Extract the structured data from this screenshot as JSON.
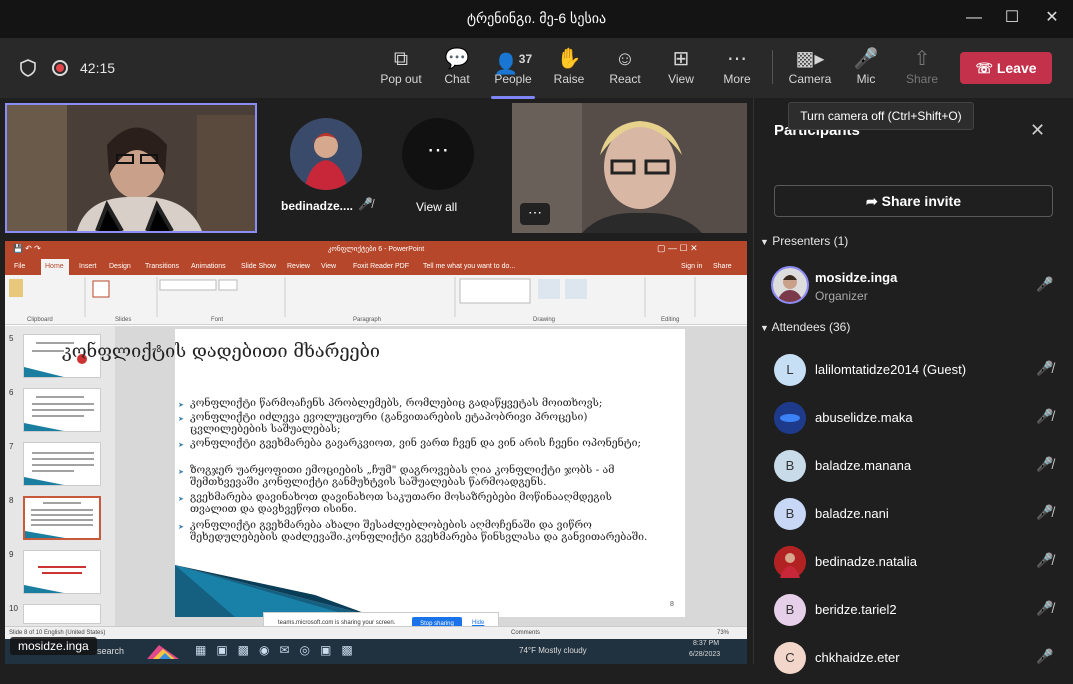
{
  "window": {
    "title": "ტრენინგი. მე-6 სესია"
  },
  "call": {
    "duration": "42:15"
  },
  "toolbar": {
    "popout": "Pop out",
    "chat": "Chat",
    "people": "People",
    "people_count": "37",
    "raise": "Raise",
    "react": "React",
    "view": "View",
    "more": "More",
    "camera": "Camera",
    "mic": "Mic",
    "share": "Share",
    "leave": "Leave"
  },
  "tooltip": "Turn camera off (Ctrl+Shift+O)",
  "tiles": {
    "bedinadze_name": "bedinadze....",
    "view_all": "View all",
    "self_name": "mosidze.inga"
  },
  "panel": {
    "title": "Participants",
    "share_invite": "Share invite",
    "presenters_header": "Presenters (1)",
    "attendees_header": "Attendees (36)",
    "presenter": {
      "name": "mosidze.inga",
      "role": "Organizer"
    },
    "attendees": [
      {
        "initial": "L",
        "name": "lalilomtatidze2014 (Guest)",
        "color": "#c7dff5"
      },
      {
        "initial": "",
        "name": "abuselidze.maka",
        "color": "#1e3a8a"
      },
      {
        "initial": "B",
        "name": "baladze.manana",
        "color": "#c8dbe8"
      },
      {
        "initial": "B",
        "name": "baladze.nani",
        "color": "#c7d7f5"
      },
      {
        "initial": "",
        "name": "bedinadze.natalia",
        "color": "#b22222"
      },
      {
        "initial": "B",
        "name": "beridze.tariel2",
        "color": "#e6cfe8"
      },
      {
        "initial": "C",
        "name": "chkhaidze.eter",
        "color": "#f2d6c9"
      }
    ]
  },
  "ppt": {
    "window_title": "კონფლიქტები 6 - PowerPoint",
    "tabs": [
      "File",
      "Home",
      "Insert",
      "Design",
      "Transitions",
      "Animations",
      "Slide Show",
      "Review",
      "View",
      "Foxit Reader PDF"
    ],
    "tell_me": "Tell me what you want to do...",
    "sign_in": "Sign in",
    "share": "Share",
    "groups": [
      "Clipboard",
      "Slides",
      "Font",
      "Paragraph",
      "Drawing",
      "Editing"
    ],
    "slide_title": "კონფლიქტის დადებითი მხარეები",
    "bullets": [
      "კონფლიქტი წარმოაჩენს პრობლემებს, რომლებიც გადაწყვეტას მოითხოვს;",
      "კონფლიქტი იძლევა ევოლუციური (განვითარების ეტაპობრივი პროცესი) ცვლილებების საშუალებას;",
      "კონფლიქტი გვეხმარება გავარკვიოთ, ვინ ვართ ჩვენ და ვინ არის ჩვენი ოპონენტი;",
      "ზოგჯერ უარყოფითი ემოციების „ჩუმ\" დაგროვებას ღია კონფლიქტი ჯობს - ამ შემთხვევაში კონფლიქტი განმუხტვის საშუალებას წარმოადგენს.",
      "გვეხმარება დავინახოთ დავინახოთ საკუთარი მოსაზრებები მოწინააღმდეგის თვალით და დავხვეწოთ ისინი.",
      "კონფლიქტი გვეხმარება ახალი შესაძლებლობების აღმოჩენაში და ვიწრო შეხედულებების დაძლევაში.კონფლიქტი გვეხმარება წინსვლასა და განვითარებაში."
    ],
    "slide_numbers": [
      "5",
      "6",
      "7",
      "8",
      "9",
      "10"
    ],
    "page_number": "8",
    "sharing_text": "teams.microsoft.com is sharing your screen.",
    "stop_sharing": "Stop sharing",
    "hide": "Hide",
    "status_left": "Slide 8 of 10   English (United States)",
    "comments": "Comments",
    "zoom": "73%"
  },
  "taskbar": {
    "search": "search",
    "weather": "74°F  Mostly cloudy",
    "time": "8:37 PM",
    "date": "6/28/2023"
  }
}
